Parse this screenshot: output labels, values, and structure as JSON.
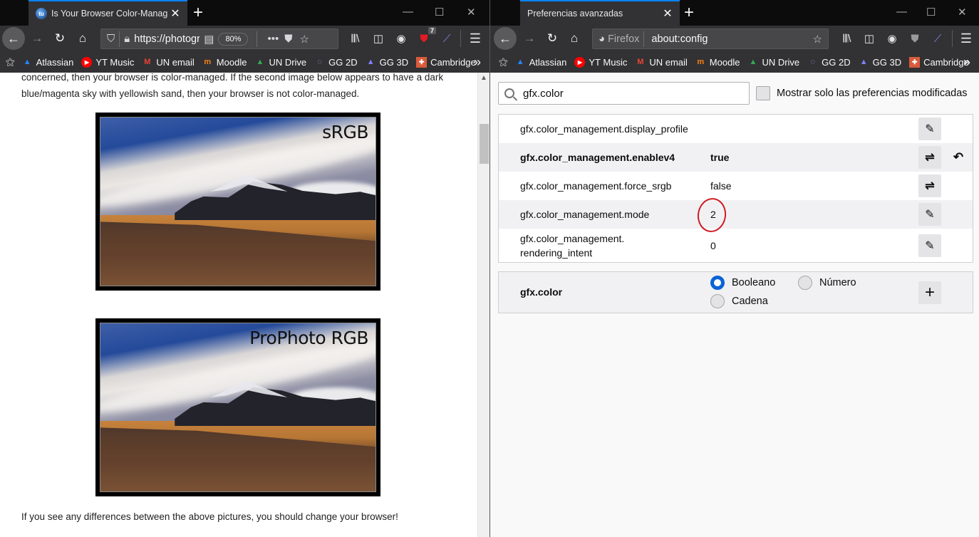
{
  "left_window": {
    "tab": {
      "title": "Is Your Browser Color-Managed",
      "favicon": "site-logo-icon"
    },
    "url": "https://photogr",
    "zoom_level": "80%",
    "extension_badge_count": "7",
    "bookmarks": [
      {
        "label": "Atlassian",
        "icon": "atlassian-icon",
        "color": "#2684ff"
      },
      {
        "label": "YT Music",
        "icon": "youtube-music-icon",
        "color": "#ff0000"
      },
      {
        "label": "UN email",
        "icon": "gmail-icon",
        "color": "#ea4335"
      },
      {
        "label": "Moodle",
        "icon": "moodle-icon",
        "color": "#f98012"
      },
      {
        "label": "UN Drive",
        "icon": "google-drive-icon",
        "color": "#34a853"
      },
      {
        "label": "GG 2D",
        "icon": "geogebra-2d-icon",
        "color": "#9999ff"
      },
      {
        "label": "GG 3D",
        "icon": "geogebra-3d-icon",
        "color": "#8080ff"
      },
      {
        "label": "Cambridge",
        "icon": "cambridge-icon",
        "color": "#d95b3c"
      }
    ],
    "content": {
      "paragraph_top_line1": "concerned, then your browser is color-managed. If the second image below appears to have a dark",
      "paragraph_top_line2": "blue/magenta sky with yellowish sand, then your browser is not color-managed.",
      "image1_label": "sRGB",
      "image2_label": "ProPhoto RGB",
      "paragraph_bottom": "If you see any differences between the above pictures, you should change your browser!"
    }
  },
  "right_window": {
    "tab": {
      "title": "Preferencias avanzadas"
    },
    "identity_label": "Firefox",
    "url": "about:config",
    "bookmarks": [
      {
        "label": "Atlassian",
        "icon": "atlassian-icon",
        "color": "#2684ff"
      },
      {
        "label": "YT Music",
        "icon": "youtube-music-icon",
        "color": "#ff0000"
      },
      {
        "label": "UN email",
        "icon": "gmail-icon",
        "color": "#ea4335"
      },
      {
        "label": "Moodle",
        "icon": "moodle-icon",
        "color": "#f98012"
      },
      {
        "label": "UN Drive",
        "icon": "google-drive-icon",
        "color": "#34a853"
      },
      {
        "label": "GG 2D",
        "icon": "geogebra-2d-icon",
        "color": "#9999ff"
      },
      {
        "label": "GG 3D",
        "icon": "geogebra-3d-icon",
        "color": "#8080ff"
      },
      {
        "label": "Cambridge",
        "icon": "cambridge-icon",
        "color": "#d95b3c"
      }
    ],
    "config": {
      "search_value": "gfx.color",
      "show_modified_label": "Mostrar solo las preferencias modificadas",
      "show_modified_checked": false,
      "prefs": [
        {
          "name": "gfx.color_management.display_profile",
          "value": "",
          "action": "edit",
          "modified": false
        },
        {
          "name": "gfx.color_management.enablev4",
          "value": "true",
          "action": "toggle",
          "modified": true
        },
        {
          "name": "gfx.color_management.force_srgb",
          "value": "false",
          "action": "toggle",
          "modified": false
        },
        {
          "name": "gfx.color_management.mode",
          "value": "2",
          "action": "edit",
          "modified": false,
          "annotated": true
        },
        {
          "name_line1": "gfx.color_management.",
          "name_line2": "rendering_intent",
          "value": "0",
          "action": "edit",
          "modified": false
        }
      ],
      "new_pref": {
        "name": "gfx.color",
        "types": [
          "Booleano",
          "Número",
          "Cadena"
        ],
        "selected_type": "Booleano"
      }
    }
  },
  "colors": {
    "accent": "#0a84ff",
    "annotation": "#d01c24",
    "radio_selected": "#0a63d8"
  }
}
